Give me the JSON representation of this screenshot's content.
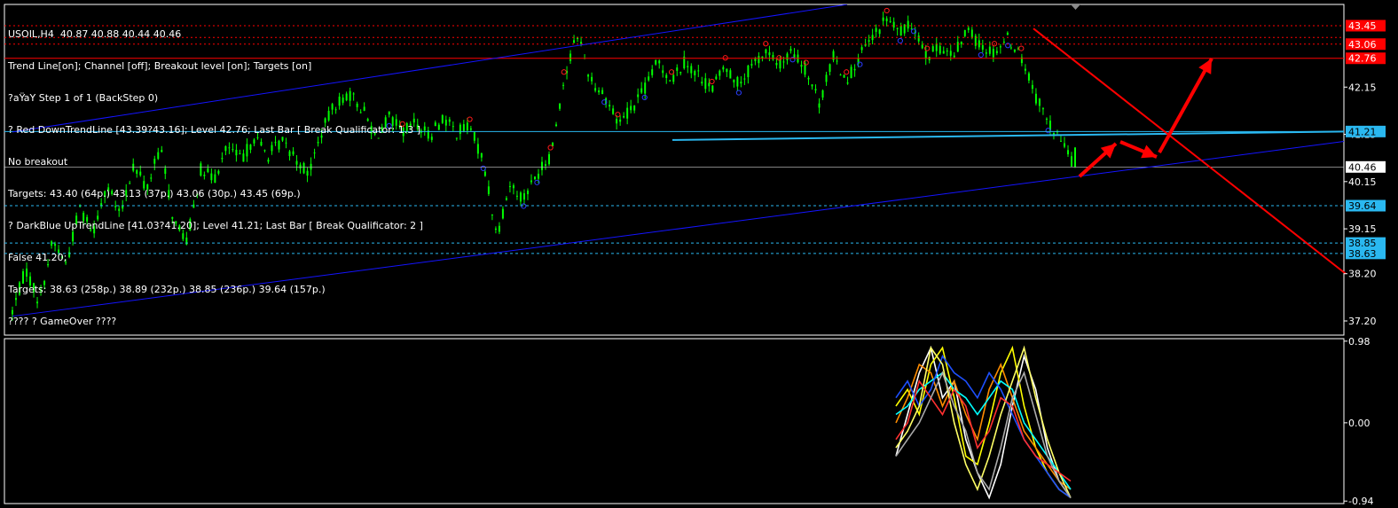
{
  "symbol_header": "USOIL,H4  40.87 40.88 40.44 40.46",
  "info_lines": [
    "Trend Line[on]; Channel [off]; Breakout level [on]; Targets [on]",
    "?aŸaY Step 1 of 1 (BackStep 0)",
    "? Red DownTrendLine [43.39?43.16]; Level 42.76; Last Bar [ Break Qualificator: 1.3 ]",
    "No breakout",
    "Targets: 43.40 (64p.) 43.13 (37p.) 43.06 (30p.) 43.45 (69p.)",
    "? DarkBlue UpTrendLine [41.03?41.20]; Level 41.21; Last Bar [ Break Qualificator: 2 ]",
    "False 41.20;",
    "Targets: 38.63 (258p.) 38.89 (232p.) 38.85 (236p.) 39.64 (157p.)",
    "???? ? GameOver ????"
  ],
  "colors": {
    "background": "#000000",
    "candle": "#00ff00",
    "frame": "#ffffff",
    "red_line": "#ff0000",
    "blue_line": "#1414ff",
    "cyan_line": "#2ab8f0",
    "price_label_red": "#ff0000",
    "price_label_cyan": "#2ab8f0",
    "price_label_current": "#ffffff"
  },
  "chart_data": [
    {
      "type": "candlestick",
      "title": "USOIL,H4",
      "ohlc_last": {
        "open": 40.87,
        "high": 40.88,
        "low": 40.44,
        "close": 40.46
      },
      "ylim": [
        36.9,
        43.9
      ],
      "y_ticks": [
        42.15,
        41.15,
        40.15,
        39.15,
        38.2,
        37.2
      ],
      "price_path": [
        37.4,
        38.3,
        37.6,
        38.9,
        38.4,
        39.6,
        39.1,
        40.1,
        39.4,
        40.5,
        40.0,
        40.9,
        39.3,
        38.9,
        40.4,
        40.2,
        40.9,
        40.6,
        41.1,
        40.7,
        41.0,
        40.7,
        40.3,
        41.2,
        41.8,
        42.0,
        41.7,
        41.1,
        41.5,
        41.2,
        41.4,
        41.1,
        41.5,
        41.2,
        41.3,
        40.6,
        39.0,
        40.1,
        39.8,
        40.3,
        40.7,
        42.3,
        43.3,
        42.3,
        42.0,
        41.4,
        41.7,
        42.1,
        42.7,
        42.3,
        42.7,
        42.4,
        42.1,
        42.6,
        42.2,
        42.6,
        42.9,
        42.6,
        42.9,
        42.5,
        41.8,
        42.8,
        42.3,
        42.8,
        43.2,
        43.6,
        43.3,
        43.5,
        42.8,
        43.0,
        42.8,
        43.4,
        43.0,
        42.9,
        43.2,
        42.8,
        42.0,
        41.4,
        41.0,
        40.46
      ],
      "swing_high_markers": [
        29,
        34,
        40,
        41,
        45,
        49,
        52,
        53,
        56,
        57,
        59,
        62,
        65,
        68,
        73,
        75
      ],
      "swing_low_markers": [
        28,
        35,
        38,
        39,
        44,
        47,
        54,
        58,
        63,
        66,
        67,
        72,
        74,
        77
      ],
      "levels": [
        {
          "name": "target",
          "price": 43.45,
          "label": "43.45",
          "style": "dotted-red"
        },
        {
          "name": "target",
          "price": 43.06,
          "label": "43.06",
          "style": "dotted-red"
        },
        {
          "name": "breakout",
          "price": 42.76,
          "label": "42.76",
          "style": "solid-red"
        },
        {
          "name": "uptrend-level",
          "price": 41.21,
          "label": "41.21",
          "style": "solid-cyan"
        },
        {
          "name": "current-price",
          "price": 40.46,
          "label": "40.46",
          "style": "solid-white"
        },
        {
          "name": "target",
          "price": 39.64,
          "label": "39.64",
          "style": "dashed-cyan"
        },
        {
          "name": "target",
          "price": 38.85,
          "label": "38.85",
          "style": "dashed-cyan"
        },
        {
          "name": "target",
          "price": 38.63,
          "label": "38.63",
          "style": "dashed-cyan"
        }
      ],
      "extra_red_dotted_price": 43.2,
      "down_trendline": {
        "from_price": 43.39,
        "to_price": 38.2
      },
      "up_trendline": {
        "from_price": 37.3,
        "to_price": 41.0
      },
      "upper_blue_line": {
        "from_price": 41.2,
        "to_price": 43.9
      },
      "arrows_drawn": 3
    },
    {
      "type": "line",
      "name": "oscillator",
      "ylim": [
        -0.97,
        1.01
      ],
      "y_ticks": [
        0.98,
        0.0,
        -0.94
      ],
      "series": [
        {
          "color": "#ffffff",
          "values": [
            -0.4,
            0.1,
            0.6,
            0.9,
            0.3,
            0.5,
            -0.2,
            -0.6,
            -0.9,
            -0.5,
            0.2,
            0.8,
            0.4,
            -0.3,
            -0.7,
            -0.9
          ]
        },
        {
          "color": "#ffff00",
          "values": [
            0.2,
            0.4,
            0.1,
            0.7,
            0.9,
            0.3,
            -0.4,
            -0.5,
            0.0,
            0.6,
            0.9,
            0.2,
            -0.3,
            -0.6,
            -0.8,
            -0.9
          ]
        },
        {
          "color": "#ff8c00",
          "values": [
            0.0,
            0.3,
            0.7,
            0.6,
            0.2,
            0.5,
            0.1,
            -0.2,
            0.4,
            0.7,
            0.3,
            -0.1,
            -0.3,
            -0.5,
            -0.7,
            -0.8
          ]
        },
        {
          "color": "#00ffff",
          "values": [
            0.1,
            0.2,
            0.4,
            0.5,
            0.6,
            0.4,
            0.3,
            0.1,
            0.3,
            0.5,
            0.4,
            0.0,
            -0.2,
            -0.4,
            -0.6,
            -0.8
          ]
        },
        {
          "color": "#1e50ff",
          "values": [
            0.3,
            0.5,
            0.2,
            0.4,
            0.8,
            0.6,
            0.5,
            0.3,
            0.6,
            0.4,
            0.1,
            -0.2,
            -0.4,
            -0.6,
            -0.8,
            -0.9
          ]
        },
        {
          "color": "#ffff66",
          "values": [
            -0.3,
            -0.1,
            0.2,
            0.9,
            0.7,
            0.0,
            -0.5,
            -0.8,
            -0.4,
            0.1,
            0.5,
            0.9,
            0.3,
            -0.2,
            -0.6,
            -0.9
          ]
        },
        {
          "color": "#ff3030",
          "values": [
            -0.2,
            0.0,
            0.5,
            0.3,
            0.1,
            0.4,
            0.2,
            -0.3,
            -0.1,
            0.3,
            0.2,
            -0.2,
            -0.4,
            -0.5,
            -0.6,
            -0.7
          ]
        },
        {
          "color": "#aaaaaa",
          "values": [
            -0.4,
            -0.2,
            0.0,
            0.3,
            0.6,
            0.2,
            -0.1,
            -0.6,
            -0.8,
            -0.3,
            0.3,
            0.6,
            0.1,
            -0.4,
            -0.7,
            -0.9
          ]
        }
      ]
    }
  ]
}
